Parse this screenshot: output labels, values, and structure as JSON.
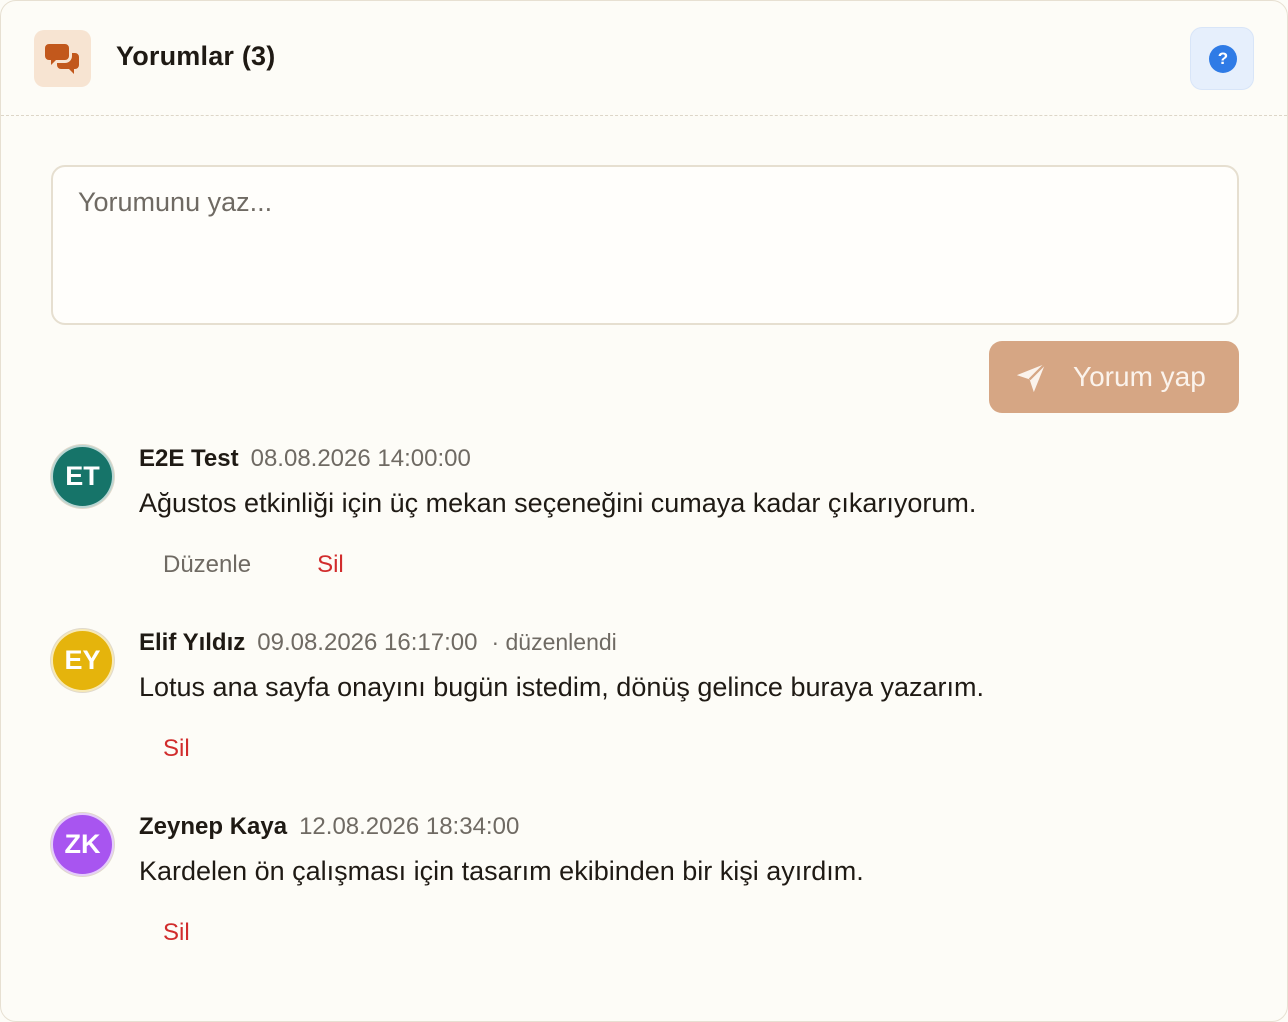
{
  "header": {
    "title": "Yorumlar (3)",
    "icon": "chat-bubbles-icon",
    "help_symbol": "?",
    "help_icon": "question-icon"
  },
  "composer": {
    "placeholder": "Yorumunu yaz...",
    "value": "",
    "submit_label": "Yorum yap",
    "submit_icon": "send-icon"
  },
  "comments": [
    {
      "initials": "ET",
      "avatar_color": "#167469",
      "author": "E2E Test",
      "time": "08.08.2026 14:00:00",
      "edited": "",
      "text": "Ağustos etkinliği için üç mekan seçeneğini cumaya kadar çıkarıyorum.",
      "edit_label": "Düzenle",
      "delete_label": "Sil"
    },
    {
      "initials": "EY",
      "avatar_color": "#e5b40c",
      "author": "Elif Yıldız",
      "time": "09.08.2026 16:17:00",
      "edited": "· düzenlendi",
      "text": "Lotus ana sayfa onayını bugün istedim, dönüş gelince buraya yazarım.",
      "edit_label": "",
      "delete_label": "Sil"
    },
    {
      "initials": "ZK",
      "avatar_color": "#a855f0",
      "author": "Zeynep Kaya",
      "time": "12.08.2026 18:34:00",
      "edited": "",
      "text": "Kardelen ön çalışması için tasarım ekibinden bir kişi ayırdım.",
      "edit_label": "",
      "delete_label": "Sil"
    }
  ],
  "colors": {
    "accent": "#d6a684",
    "danger": "#d12c2c",
    "help": "#2f7be6",
    "header_icon": "#c2581c"
  }
}
